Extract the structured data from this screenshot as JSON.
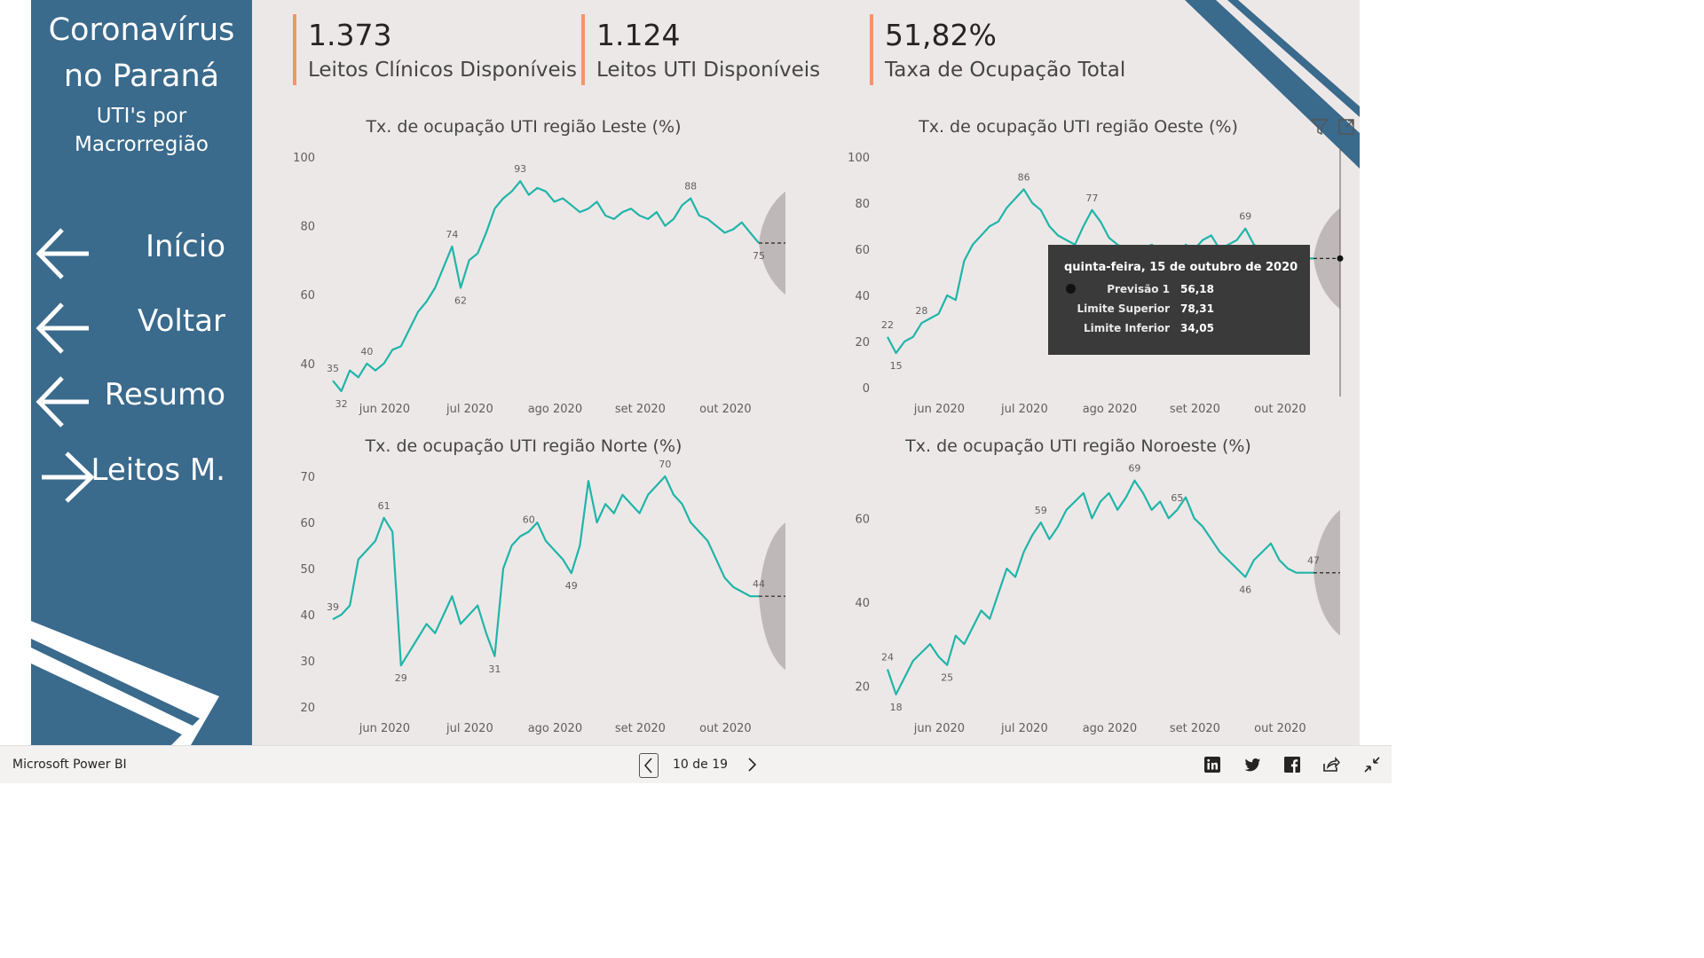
{
  "colors": {
    "sidebar": "#3a6a8c",
    "canvas": "#ede8e8",
    "line": "#1fb5a8",
    "kpi_accent": "#f2956a",
    "forecast": "#b9b3b3"
  },
  "sidebar": {
    "title1": "Coronavírus",
    "title2": "no Paraná",
    "subtitle1": "UTI's por",
    "subtitle2": "Macrorregião",
    "nav": [
      {
        "label": "Início",
        "icon": "arrow-left-icon"
      },
      {
        "label": "Voltar",
        "icon": "arrow-left-icon"
      },
      {
        "label": "Resumo",
        "icon": "arrow-left-icon"
      },
      {
        "label": "Leitos M.",
        "icon": "arrow-right-icon"
      }
    ]
  },
  "kpis": [
    {
      "value": "1.373",
      "label": "Leitos Clínicos Disponíveis"
    },
    {
      "value": "1.124",
      "label": "Leitos UTI Disponíveis"
    },
    {
      "value": "51,82%",
      "label": "Taxa de Ocupação Total"
    }
  ],
  "chart_data": [
    {
      "type": "line",
      "title": "Tx. de ocupação UTI região Leste (%)",
      "x_tick_labels": [
        "jun 2020",
        "jul 2020",
        "ago 2020",
        "set 2020",
        "out 2020"
      ],
      "y_ticks": [
        40,
        60,
        80,
        100
      ],
      "ylim": [
        33,
        100
      ],
      "x": [
        0.0,
        0.02,
        0.04,
        0.06,
        0.08,
        0.1,
        0.12,
        0.14,
        0.16,
        0.18,
        0.2,
        0.22,
        0.24,
        0.26,
        0.28,
        0.3,
        0.32,
        0.34,
        0.36,
        0.38,
        0.4,
        0.42,
        0.44,
        0.46,
        0.48,
        0.5,
        0.52,
        0.54,
        0.56,
        0.58,
        0.6,
        0.62,
        0.64,
        0.66,
        0.68,
        0.7,
        0.72,
        0.74,
        0.76,
        0.78,
        0.8,
        0.82,
        0.84,
        0.86,
        0.88,
        0.9,
        0.92,
        0.94,
        0.96,
        0.98,
        1.0
      ],
      "values": [
        35,
        32,
        38,
        36,
        40,
        38,
        40,
        44,
        45,
        50,
        55,
        58,
        62,
        68,
        74,
        62,
        70,
        72,
        78,
        85,
        88,
        90,
        93,
        89,
        91,
        90,
        87,
        88,
        86,
        84,
        85,
        87,
        83,
        82,
        84,
        85,
        83,
        82,
        84,
        80,
        82,
        86,
        88,
        83,
        82,
        80,
        78,
        79,
        81,
        78,
        75
      ],
      "point_labels": [
        {
          "i": 0,
          "text": "35"
        },
        {
          "i": 1,
          "text": "32"
        },
        {
          "i": 4,
          "text": "40"
        },
        {
          "i": 14,
          "text": "74"
        },
        {
          "i": 15,
          "text": "62"
        },
        {
          "i": 22,
          "text": "93"
        },
        {
          "i": 42,
          "text": "88"
        },
        {
          "i": 50,
          "text": "75"
        }
      ],
      "forecast": {
        "value": 75,
        "upper": 90,
        "lower": 60
      }
    },
    {
      "type": "line",
      "title": "Tx. de ocupação UTI região Oeste (%)",
      "x_tick_labels": [
        "jun 2020",
        "jul 2020",
        "ago 2020",
        "set 2020",
        "out 2020"
      ],
      "y_ticks": [
        0,
        20,
        40,
        60,
        80,
        100
      ],
      "ylim": [
        0,
        100
      ],
      "x": [
        0.0,
        0.02,
        0.04,
        0.06,
        0.08,
        0.1,
        0.12,
        0.14,
        0.16,
        0.18,
        0.2,
        0.22,
        0.24,
        0.26,
        0.28,
        0.3,
        0.32,
        0.34,
        0.36,
        0.38,
        0.4,
        0.42,
        0.44,
        0.46,
        0.48,
        0.5,
        0.52,
        0.54,
        0.56,
        0.58,
        0.6,
        0.62,
        0.64,
        0.66,
        0.68,
        0.7,
        0.72,
        0.74,
        0.76,
        0.78,
        0.8,
        0.82,
        0.84,
        0.86,
        0.88,
        0.9,
        0.92,
        0.94,
        0.96,
        0.98,
        1.0
      ],
      "values": [
        22,
        15,
        20,
        22,
        28,
        30,
        32,
        40,
        38,
        55,
        62,
        66,
        70,
        72,
        78,
        82,
        86,
        80,
        77,
        70,
        66,
        64,
        62,
        70,
        77,
        72,
        65,
        62,
        60,
        58,
        60,
        62,
        60,
        58,
        56,
        62,
        60,
        64,
        66,
        60,
        62,
        64,
        69,
        62,
        60,
        58,
        60,
        58,
        57,
        56,
        56
      ],
      "point_labels": [
        {
          "i": 0,
          "text": "22"
        },
        {
          "i": 1,
          "text": "15"
        },
        {
          "i": 4,
          "text": "28"
        },
        {
          "i": 16,
          "text": "86"
        },
        {
          "i": 24,
          "text": "77"
        },
        {
          "i": 42,
          "text": "69"
        }
      ],
      "forecast": {
        "value": 56,
        "upper": 78,
        "lower": 34
      }
    },
    {
      "type": "line",
      "title": "Tx. de ocupação UTI região Norte (%)",
      "x_tick_labels": [
        "jun 2020",
        "jul 2020",
        "ago 2020",
        "set 2020",
        "out 2020"
      ],
      "y_ticks": [
        20,
        30,
        40,
        50,
        60,
        70
      ],
      "ylim": [
        20,
        70
      ],
      "x": [
        0.0,
        0.02,
        0.04,
        0.06,
        0.08,
        0.1,
        0.12,
        0.14,
        0.16,
        0.18,
        0.2,
        0.22,
        0.24,
        0.26,
        0.28,
        0.3,
        0.32,
        0.34,
        0.36,
        0.38,
        0.4,
        0.42,
        0.44,
        0.46,
        0.48,
        0.5,
        0.52,
        0.54,
        0.56,
        0.58,
        0.6,
        0.62,
        0.64,
        0.66,
        0.68,
        0.7,
        0.72,
        0.74,
        0.76,
        0.78,
        0.8,
        0.82,
        0.84,
        0.86,
        0.88,
        0.9,
        0.92,
        0.94,
        0.96,
        0.98,
        1.0
      ],
      "values": [
        39,
        40,
        42,
        52,
        54,
        56,
        61,
        58,
        29,
        32,
        35,
        38,
        36,
        40,
        44,
        38,
        40,
        42,
        36,
        31,
        50,
        55,
        57,
        58,
        60,
        56,
        54,
        52,
        49,
        55,
        69,
        60,
        64,
        62,
        66,
        64,
        62,
        66,
        68,
        70,
        66,
        64,
        60,
        58,
        56,
        52,
        48,
        46,
        45,
        44,
        44
      ],
      "point_labels": [
        {
          "i": 0,
          "text": "39"
        },
        {
          "i": 6,
          "text": "61"
        },
        {
          "i": 8,
          "text": "29"
        },
        {
          "i": 19,
          "text": "31"
        },
        {
          "i": 23,
          "text": "60"
        },
        {
          "i": 28,
          "text": "49"
        },
        {
          "i": 39,
          "text": "70"
        },
        {
          "i": 50,
          "text": "44"
        }
      ],
      "forecast": {
        "value": 44,
        "upper": 60,
        "lower": 28
      }
    },
    {
      "type": "line",
      "title": "Tx. de ocupação UTI região Noroeste (%)",
      "x_tick_labels": [
        "jun 2020",
        "jul 2020",
        "ago 2020",
        "set 2020",
        "out 2020"
      ],
      "y_ticks": [
        20,
        40,
        60
      ],
      "ylim": [
        15,
        70
      ],
      "x": [
        0.0,
        0.02,
        0.04,
        0.06,
        0.08,
        0.1,
        0.12,
        0.14,
        0.16,
        0.18,
        0.2,
        0.22,
        0.24,
        0.26,
        0.28,
        0.3,
        0.32,
        0.34,
        0.36,
        0.38,
        0.4,
        0.42,
        0.44,
        0.46,
        0.48,
        0.5,
        0.52,
        0.54,
        0.56,
        0.58,
        0.6,
        0.62,
        0.64,
        0.66,
        0.68,
        0.7,
        0.72,
        0.74,
        0.76,
        0.78,
        0.8,
        0.82,
        0.84,
        0.86,
        0.88,
        0.9,
        0.92,
        0.94,
        0.96,
        0.98,
        1.0
      ],
      "values": [
        24,
        18,
        22,
        26,
        28,
        30,
        27,
        25,
        32,
        30,
        34,
        38,
        36,
        42,
        48,
        46,
        52,
        56,
        59,
        55,
        58,
        62,
        64,
        66,
        60,
        64,
        66,
        62,
        65,
        69,
        66,
        62,
        64,
        60,
        62,
        65,
        60,
        58,
        55,
        52,
        50,
        48,
        46,
        50,
        52,
        54,
        50,
        48,
        47,
        47,
        47
      ],
      "point_labels": [
        {
          "i": 0,
          "text": "24"
        },
        {
          "i": 1,
          "text": "18"
        },
        {
          "i": 7,
          "text": "25"
        },
        {
          "i": 18,
          "text": "59"
        },
        {
          "i": 29,
          "text": "69"
        },
        {
          "i": 34,
          "text": "65"
        },
        {
          "i": 42,
          "text": "46"
        },
        {
          "i": 50,
          "text": "47"
        }
      ],
      "forecast": {
        "value": 47,
        "upper": 62,
        "lower": 32
      }
    }
  ],
  "tooltip": {
    "date": "quinta-feira, 15 de outubro de 2020",
    "rows": [
      {
        "key": "Previsão 1",
        "value": "56,18"
      },
      {
        "key": "Limite Superior",
        "value": "78,31"
      },
      {
        "key": "Limite Inferior",
        "value": "34,05"
      }
    ]
  },
  "visual_icons": [
    "filter-icon",
    "focus-mode-icon"
  ],
  "bottombar": {
    "brand": "Microsoft Power BI",
    "pager": "10 de 19",
    "icons": [
      "linkedin-icon",
      "twitter-icon",
      "facebook-icon",
      "share-icon",
      "exit-fullscreen-icon"
    ]
  }
}
